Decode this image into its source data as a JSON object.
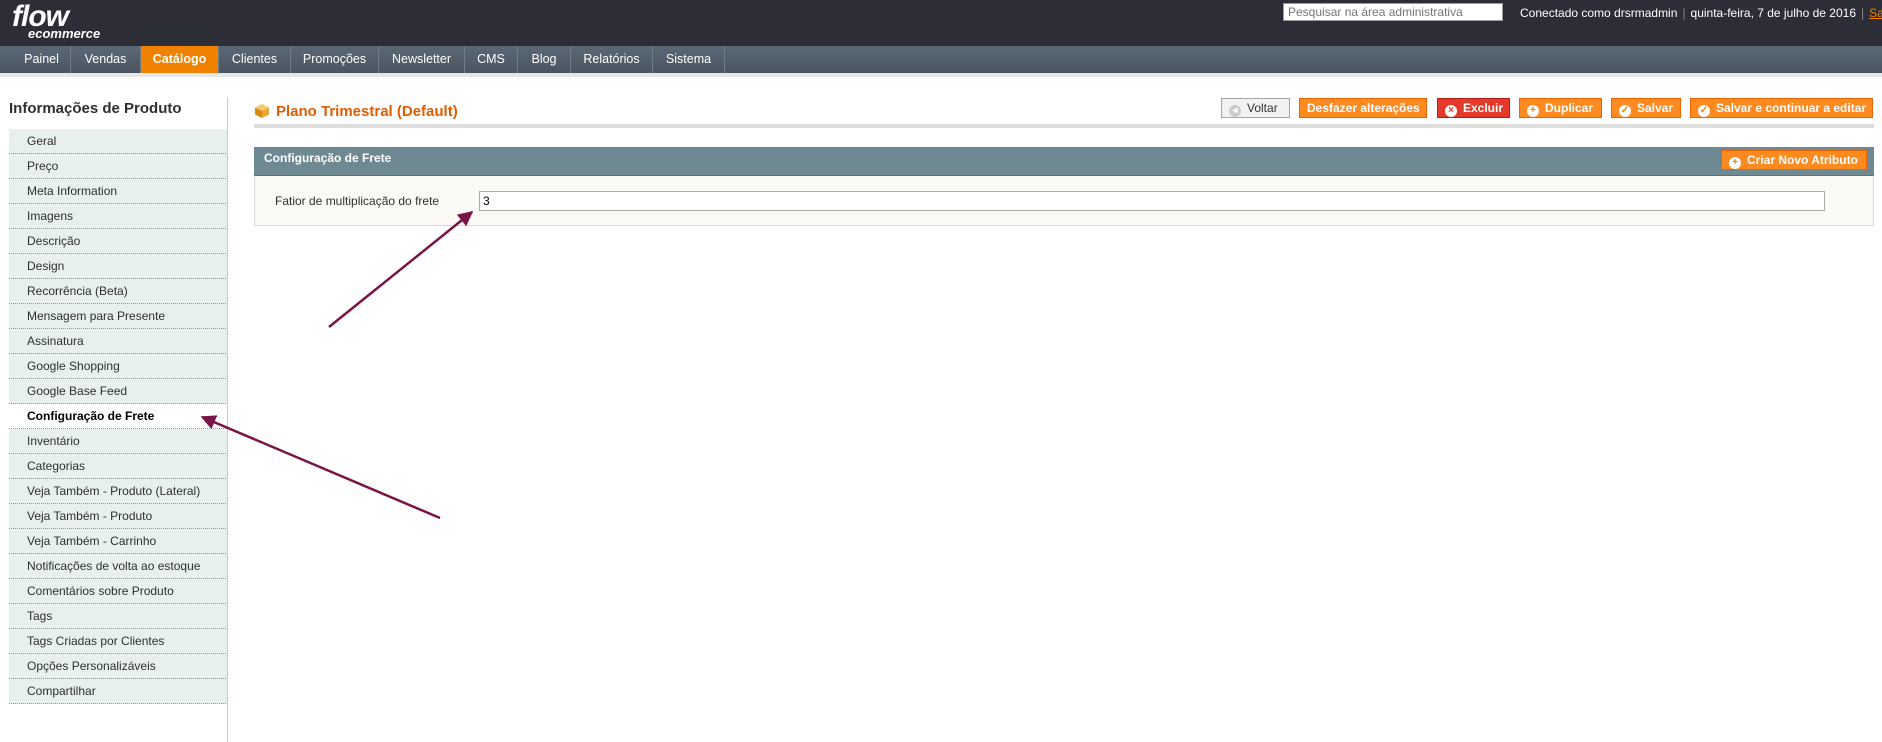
{
  "logo": {
    "line1": "flow",
    "line2": "ecommerce"
  },
  "header": {
    "search_placeholder": "Pesquisar na área administrativa",
    "logged_in": "Conectado como drsrmadmin",
    "date": "quinta-feira, 7 de julho de 2016",
    "logout": "Sair",
    "separator": "|"
  },
  "nav": {
    "items": [
      {
        "label": "Painel"
      },
      {
        "label": "Vendas"
      },
      {
        "label": "Catálogo"
      },
      {
        "label": "Clientes"
      },
      {
        "label": "Promoções"
      },
      {
        "label": "Newsletter"
      },
      {
        "label": "CMS"
      },
      {
        "label": "Blog"
      },
      {
        "label": "Relatórios"
      },
      {
        "label": "Sistema"
      }
    ],
    "active": "Catálogo"
  },
  "sidebar": {
    "title": "Informações de Produto",
    "items": [
      {
        "label": "Geral"
      },
      {
        "label": "Preço"
      },
      {
        "label": "Meta Information"
      },
      {
        "label": "Imagens"
      },
      {
        "label": "Descrição"
      },
      {
        "label": "Design"
      },
      {
        "label": "Recorrência (Beta)"
      },
      {
        "label": "Mensagem para Presente"
      },
      {
        "label": "Assinatura"
      },
      {
        "label": "Google Shopping"
      },
      {
        "label": "Google Base Feed"
      },
      {
        "label": "Configuração de Frete"
      },
      {
        "label": "Inventário"
      },
      {
        "label": "Categorias"
      },
      {
        "label": "Veja Também - Produto (Lateral)"
      },
      {
        "label": "Veja Também - Produto"
      },
      {
        "label": "Veja Também - Carrinho"
      },
      {
        "label": "Notificações de volta ao estoque"
      },
      {
        "label": "Comentários sobre Produto"
      },
      {
        "label": "Tags"
      },
      {
        "label": "Tags Criadas por Clientes"
      },
      {
        "label": "Opções Personalizáveis"
      },
      {
        "label": "Compartilhar"
      }
    ],
    "active": "Configuração de Frete"
  },
  "page": {
    "title": "Plano Trimestral (Default)",
    "icon": "product-box-icon"
  },
  "buttons": {
    "back": "Voltar",
    "reset": "Desfazer alterações",
    "delete": "Excluir",
    "duplicate": "Duplicar",
    "save": "Salvar",
    "save_continue": "Salvar e continuar a editar"
  },
  "section": {
    "title": "Configuração de Frete",
    "new_attribute": "Criar Novo Atributo",
    "field_label": "Fatior de multiplicação do frete",
    "field_value": "3"
  },
  "colors": {
    "accent": "#f18200",
    "title": "#e25d00",
    "header_bg": "#2d2d38",
    "nav_bg": "#4f5b66",
    "section_head": "#6f8992",
    "annotation_arrow": "#7a1446"
  }
}
